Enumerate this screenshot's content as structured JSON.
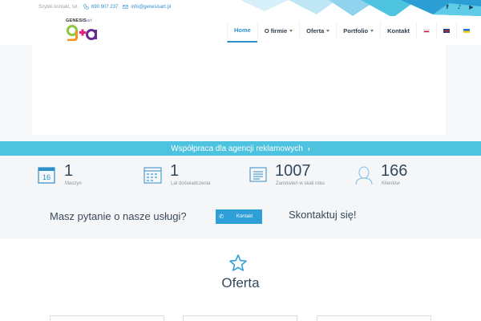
{
  "topbar": {
    "contact_prefix": "Szybki kontakt, tel.",
    "phone": "690 907 237",
    "email": "info@genesisart.pl",
    "social": [
      {
        "icon": "facebook-icon",
        "glyph": "f"
      },
      {
        "icon": "tiktok-icon",
        "glyph": "♪"
      },
      {
        "icon": "youtube-icon",
        "glyph": "▶"
      }
    ]
  },
  "logo": {
    "brand_bold": "GENESIS",
    "brand_light": "art",
    "colors": [
      "#8cc63f",
      "#ed1e79",
      "#f7931e",
      "#662d91"
    ]
  },
  "nav": {
    "items": [
      {
        "label": "Home",
        "active": true,
        "dropdown": false
      },
      {
        "label": "O firmie",
        "active": false,
        "dropdown": true
      },
      {
        "label": "Oferta",
        "active": false,
        "dropdown": true
      },
      {
        "label": "Portfolio",
        "active": false,
        "dropdown": true
      },
      {
        "label": "Kontakt",
        "active": false,
        "dropdown": false
      }
    ],
    "languages": [
      "pl",
      "en",
      "ua"
    ],
    "accent": "#2f8fc9"
  },
  "strip": {
    "text": "Współpraca dla agencji reklamowych",
    "color": "#4ec3e0"
  },
  "stats": [
    {
      "value": "1",
      "label": "Maszyn",
      "icon": "calendar-16-icon"
    },
    {
      "value": "1",
      "label": "Lat doświadczenia",
      "icon": "calendar-grid-icon"
    },
    {
      "value": "1007",
      "label": "Zamówień w skali roku",
      "icon": "document-list-icon"
    },
    {
      "value": "166",
      "label": "Klientów",
      "icon": "user-icon"
    }
  ],
  "calendar_day": "16",
  "cta": {
    "question": "Masz pytanie o nasze usługi?",
    "button_label": "Kontakt",
    "contact_text": "Skontaktuj się!"
  },
  "oferta": {
    "title": "Oferta",
    "icon": "star-icon"
  }
}
